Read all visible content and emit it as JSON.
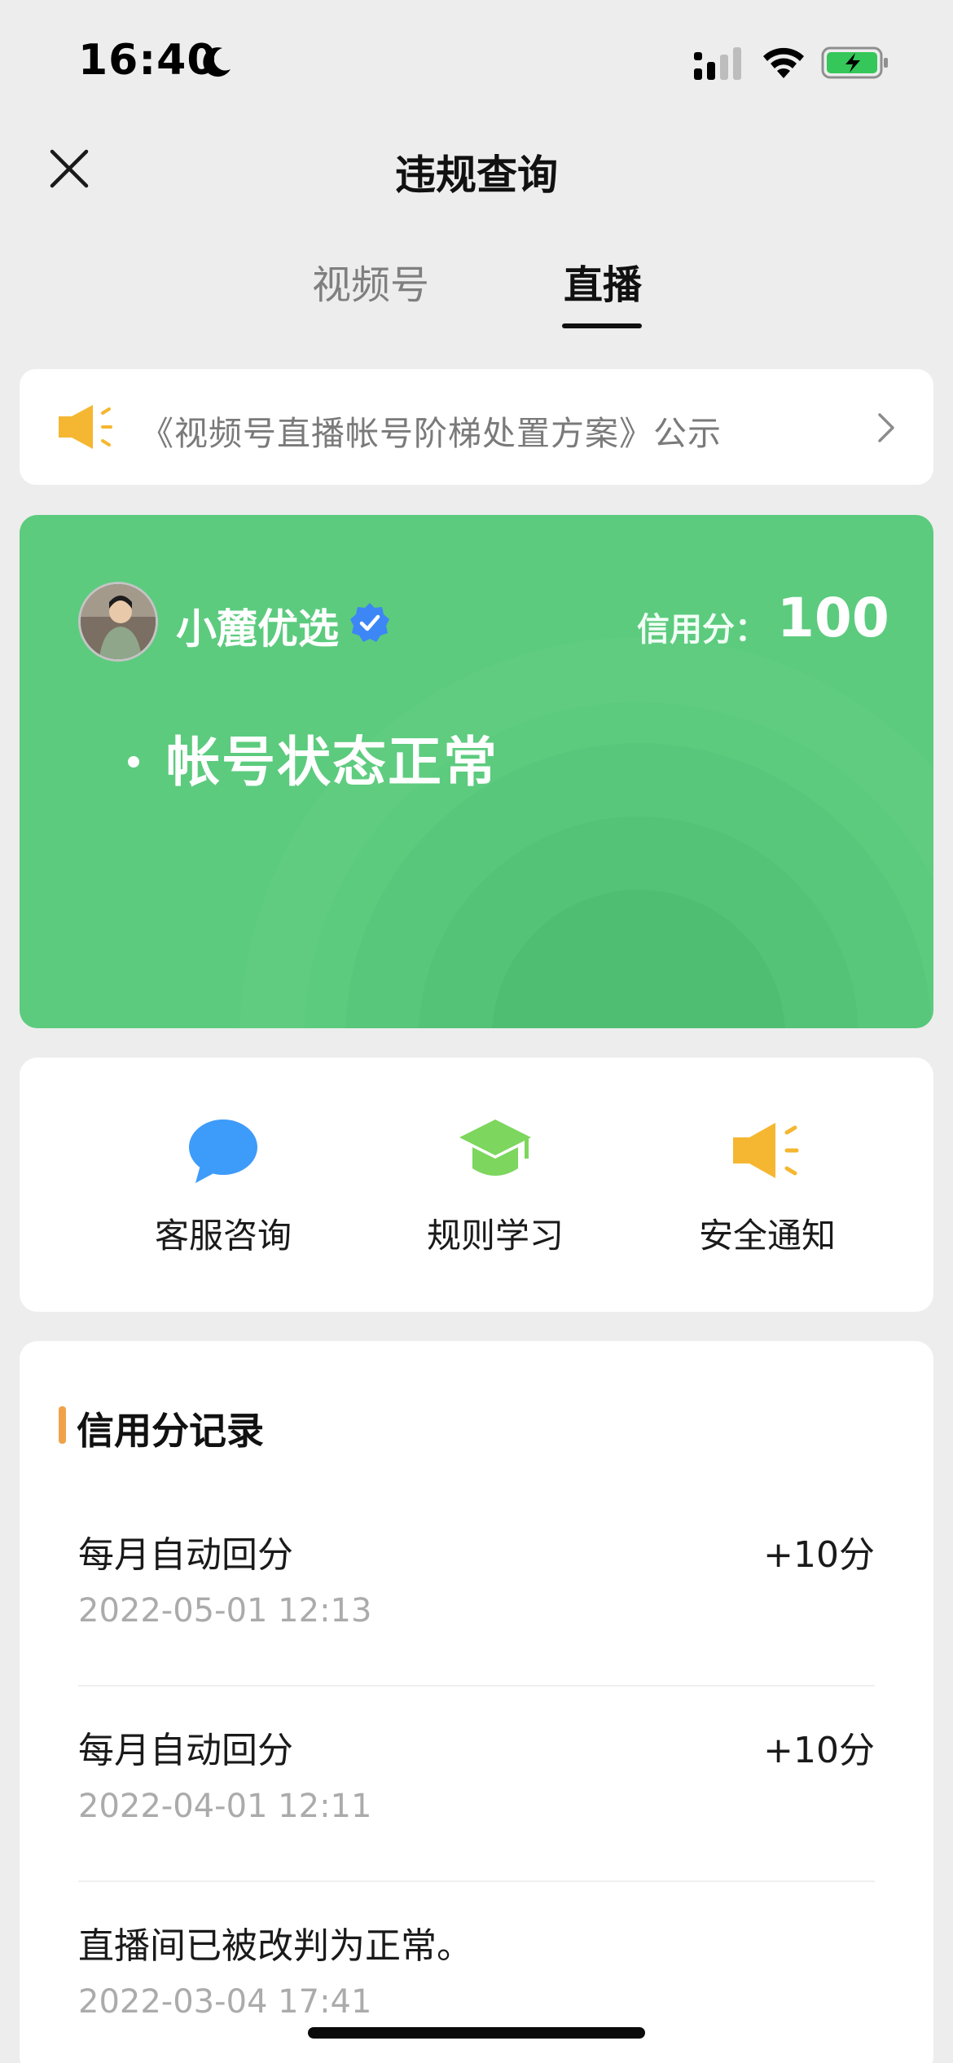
{
  "status_bar": {
    "time": "16:40",
    "icons": [
      "moon-icon",
      "signal-icon",
      "wifi-icon",
      "battery-charging-icon"
    ]
  },
  "nav": {
    "title": "违规查询",
    "close_icon": "close-icon"
  },
  "tabs": [
    {
      "label": "视频号",
      "active": false
    },
    {
      "label": "直播",
      "active": true
    }
  ],
  "notice": {
    "icon": "megaphone-icon",
    "text": "《视频号直播帐号阶梯处置方案》公示",
    "icon_color": "#F5B731"
  },
  "status_card": {
    "account_name": "小麓优选",
    "verified_icon": "verified-badge-icon",
    "credit_label": "信用分：",
    "credit_value": "100",
    "status_text": "帐号状态正常",
    "background_color": "#5CCB7E"
  },
  "actions": [
    {
      "label": "客服咨询",
      "icon": "chat-bubble-icon",
      "color": "#3D9BFA"
    },
    {
      "label": "规则学习",
      "icon": "graduation-cap-icon",
      "color": "#7DD65E"
    },
    {
      "label": "安全通知",
      "icon": "megaphone-icon",
      "color": "#F5B731"
    }
  ],
  "records": {
    "title": "信用分记录",
    "accent_color": "#F0A24A",
    "items": [
      {
        "desc": "每月自动回分",
        "points": "+10分",
        "time": "2022-05-01 12:13"
      },
      {
        "desc": "每月自动回分",
        "points": "+10分",
        "time": "2022-04-01 12:11"
      },
      {
        "desc": "直播间已被改判为正常。",
        "points": "",
        "time": "2022-03-04 17:41"
      }
    ]
  }
}
